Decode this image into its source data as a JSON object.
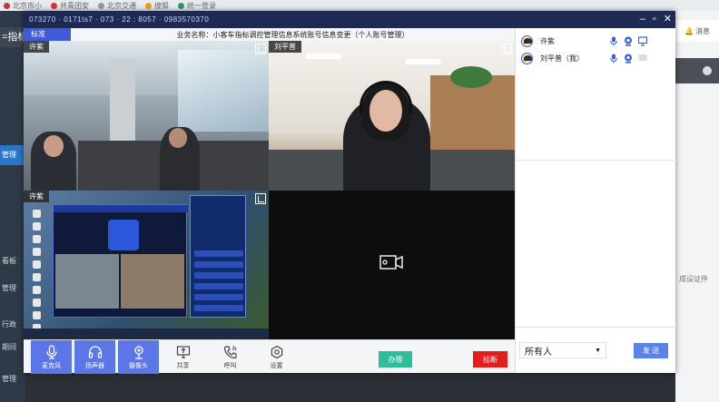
{
  "browser": {
    "tabs": [
      "北京市小",
      "共青团安",
      "北京交通",
      "搜狐",
      "统一登录"
    ]
  },
  "bg_app": {
    "left_title": "=指标",
    "left_menu": [
      "管理",
      "看板",
      "管理",
      "行政",
      "期间",
      "管理"
    ],
    "right_head": "消息",
    "right_link": "成设证件"
  },
  "dialog": {
    "title_text": "073270 · 0171ts7 · 073 · 22 : 8057 · 0983570370",
    "subbar_tag": "标准",
    "business_name": "业务名称：小客车指标调控管理信息系统账号信息变更（个人账号管理）",
    "tiles": [
      {
        "name": "许紫"
      },
      {
        "name": "刘平普"
      },
      {
        "name": "许紫"
      },
      {
        "name": ""
      }
    ],
    "toolbar": {
      "buttons": [
        {
          "label": "麦克风",
          "icon": "microphone-icon",
          "active": true
        },
        {
          "label": "扬声器",
          "icon": "headphones-icon",
          "active": true
        },
        {
          "label": "摄像头",
          "icon": "camera-icon",
          "active": true
        },
        {
          "label": "共享",
          "icon": "screen-share-icon",
          "active": false
        },
        {
          "label": "呼叫",
          "icon": "phone-call-icon",
          "active": false
        },
        {
          "label": "设置",
          "icon": "settings-icon",
          "active": false
        }
      ],
      "handle_label": "办理",
      "hangup_label": "挂断"
    },
    "participants": [
      {
        "name": "许紫"
      },
      {
        "name": "刘平普（我）"
      }
    ],
    "recipient_value": "所有人",
    "send_label": "发 送"
  },
  "colors": {
    "titlebar": "#1e2a54",
    "accent": "#5b76e6",
    "handle": "#2ebc9a",
    "hangup": "#e41d1d"
  }
}
